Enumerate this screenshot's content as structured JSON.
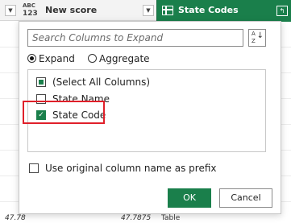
{
  "header": {
    "type_badge_top": "ABC",
    "type_badge_bottom": "123",
    "column_new_score": "New score",
    "column_state_codes": "State Codes"
  },
  "background_row": {
    "left_value": "47.78",
    "right_value": "47.7875",
    "right_cell": "Table"
  },
  "popup": {
    "search_placeholder": "Search Columns to Expand",
    "sort_top": "A",
    "sort_bottom": "Z",
    "mode_options": [
      {
        "label": "Expand",
        "selected": true
      },
      {
        "label": "Aggregate",
        "selected": false
      }
    ],
    "columns": [
      {
        "label": "(Select All Columns)",
        "state": "partial"
      },
      {
        "label": "State Name",
        "state": "unchecked"
      },
      {
        "label": "State Code",
        "state": "checked"
      }
    ],
    "prefix_label": "Use original column name as prefix",
    "prefix_checked": false,
    "ok_label": "OK",
    "cancel_label": "Cancel"
  },
  "colors": {
    "accent": "#1a7f4b",
    "highlight": "#e0202a"
  }
}
